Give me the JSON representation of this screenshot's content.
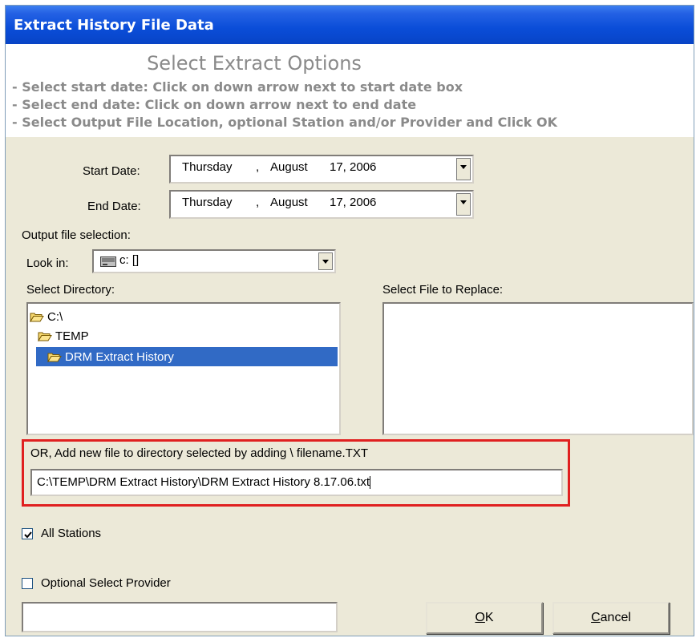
{
  "window": {
    "title": "Extract History File Data"
  },
  "header": {
    "title": "Select Extract Options",
    "lines": [
      "- Select start date: Click on down arrow next to start date box",
      "- Select end date:  Click on down arrow next to end date",
      "- Select Output File Location, optional Station and/or Provider and Click OK"
    ]
  },
  "start_date": {
    "label": "Start Date:",
    "weekday": "Thursday",
    "sep": ",",
    "month": "August",
    "day_year": "17, 2006"
  },
  "end_date": {
    "label": "End Date:",
    "weekday": "Thursday",
    "sep": ",",
    "month": "August",
    "day_year": "17, 2006"
  },
  "output": {
    "label": "Output file selection:",
    "look_in_label": "Look in:",
    "look_in_value": "c: []",
    "drive_icon": "drive-icon"
  },
  "directory": {
    "label": "Select Directory:",
    "items": [
      {
        "label": "C:\\",
        "icon": "open-folder-icon",
        "selected": false
      },
      {
        "label": "TEMP",
        "icon": "open-folder-icon",
        "selected": false
      },
      {
        "label": "DRM Extract History",
        "icon": "open-folder-icon",
        "selected": true
      }
    ]
  },
  "replace_file": {
    "label": "Select File to Replace:"
  },
  "new_file": {
    "label": "OR, Add new file to directory selected by adding  \\ filename.TXT",
    "value": "C:\\TEMP\\DRM Extract History\\DRM Extract History 8.17.06.txt"
  },
  "all_stations": {
    "label": "All Stations",
    "checked": true
  },
  "provider": {
    "label": "Optional Select Provider",
    "checked": false,
    "value": ""
  },
  "buttons": {
    "ok_mnemonic": "O",
    "ok_rest": "K",
    "cancel_mnemonic": "C",
    "cancel_rest": "ancel"
  },
  "colors": {
    "titlebar": "#0a4dd8",
    "selection": "#316ac5",
    "highlight_box": "#e02020"
  }
}
